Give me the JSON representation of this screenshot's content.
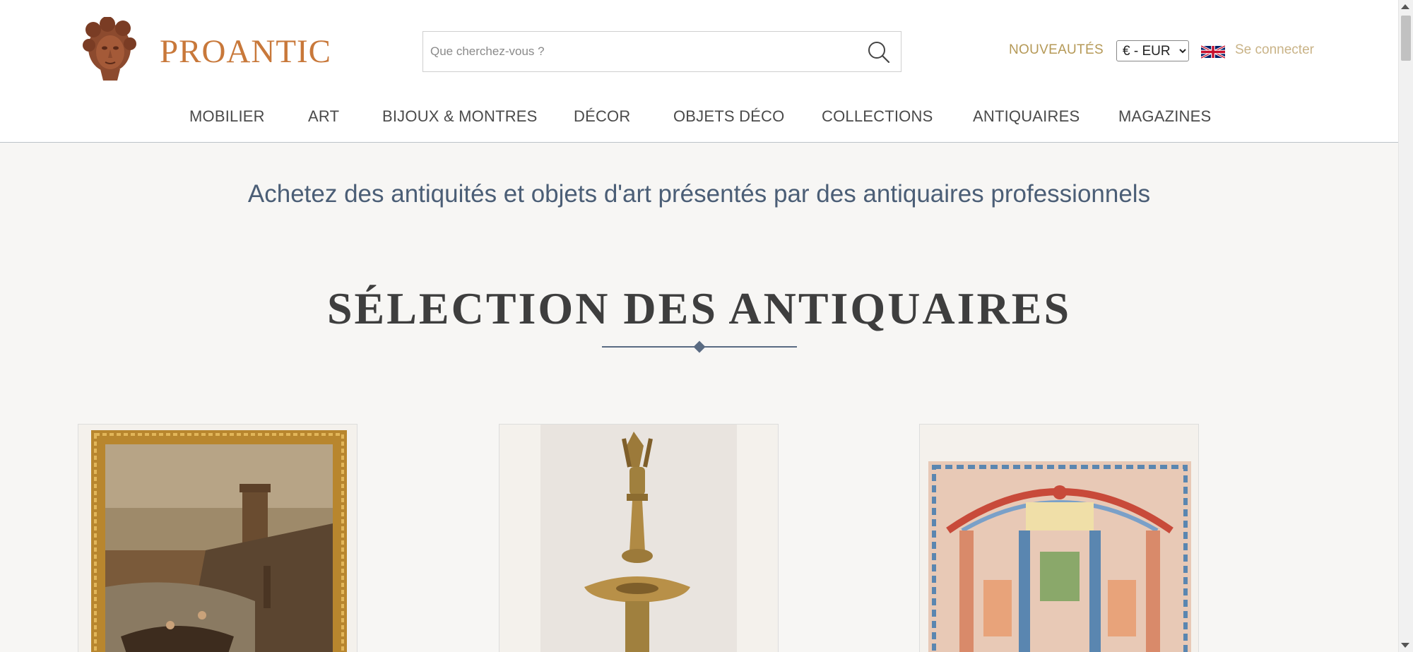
{
  "header": {
    "logo_text": "PROANTIC",
    "search": {
      "placeholder": "Que cherchez-vous ?"
    },
    "nouveautes": "NOUVEAUTÉS",
    "currency": {
      "selected": "€ - EUR",
      "options": [
        "€ - EUR"
      ]
    },
    "language_flag": "uk-flag-icon",
    "login_label": "Se connecter"
  },
  "nav": {
    "items": [
      {
        "label": "MOBILIER"
      },
      {
        "label": "ART"
      },
      {
        "label": "BIJOUX & MONTRES"
      },
      {
        "label": "DÉCOR"
      },
      {
        "label": "OBJETS DÉCO"
      },
      {
        "label": "COLLECTIONS"
      },
      {
        "label": "ANTIQUAIRES"
      },
      {
        "label": "MAGAZINES"
      }
    ]
  },
  "main": {
    "tagline": "Achetez des antiquités et objets d'art présentés par des antiquaires professionnels",
    "section_title": "SÉLECTION DES ANTIQUAIRES",
    "cards": [
      {
        "image": "framed-seascape-painting"
      },
      {
        "image": "brass-candlestick"
      },
      {
        "image": "embroidered-textile"
      }
    ]
  },
  "colors": {
    "brand": "#c8783a",
    "gold": "#b59957",
    "tagline": "#4b5e76",
    "title": "#3e3e3e",
    "background": "#f7f6f4"
  }
}
